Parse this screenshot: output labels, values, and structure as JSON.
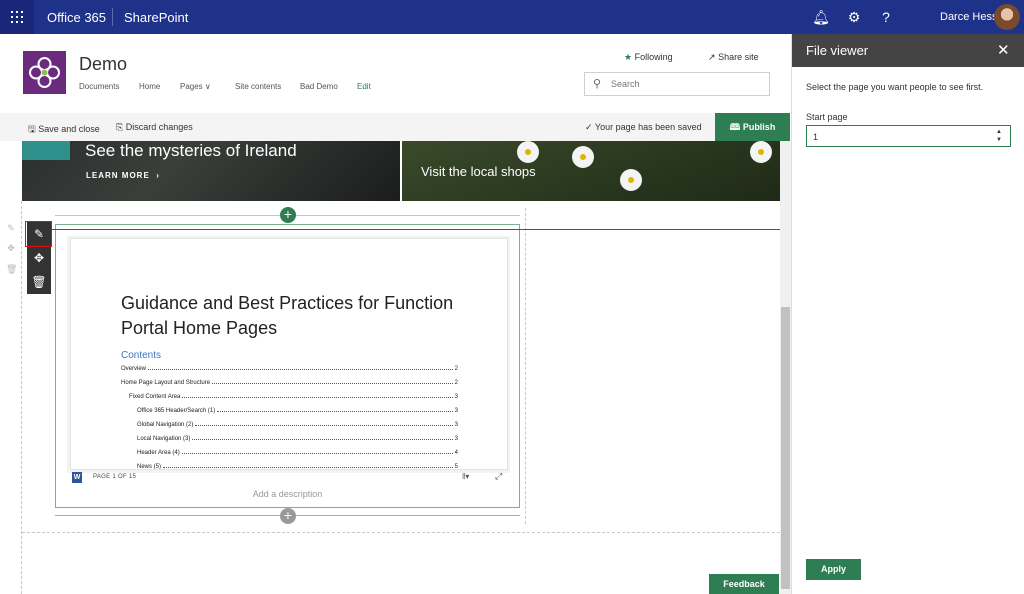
{
  "suite": {
    "app_launcher": "waffle-icon",
    "brand": "Office 365",
    "app": "SharePoint",
    "icons": [
      "bell-icon",
      "gear-icon",
      "help-icon"
    ],
    "user_name": "Darce Hess"
  },
  "site": {
    "title": "Demo",
    "nav": [
      "Documents",
      "Home",
      "Pages",
      "Site contents",
      "Bad Demo",
      "Edit"
    ],
    "following": "Following",
    "share": "Share site",
    "search_placeholder": "Search"
  },
  "command_bar": {
    "save_close": "Save and close",
    "discard": "Discard changes",
    "status": "Your page has been saved",
    "publish": "Publish"
  },
  "hero": {
    "left_title": "See the mysteries of Ireland",
    "left_link": "LEARN MORE",
    "right_title": "Visit the local shops"
  },
  "document": {
    "title": "Guidance and Best Practices for Function Portal Home Pages",
    "contents_heading": "Contents",
    "toc": [
      {
        "text": "Overview",
        "page": "2",
        "level": 0
      },
      {
        "text": "Home Page Layout and Structure",
        "page": "2",
        "level": 0
      },
      {
        "text": "Fixed Content Area",
        "page": "3",
        "level": 1
      },
      {
        "text": "Office 365 Header/Search (1)",
        "page": "3",
        "level": 2
      },
      {
        "text": "Global Navigation (2)",
        "page": "3",
        "level": 2
      },
      {
        "text": "Local Navigation (3)",
        "page": "3",
        "level": 2
      },
      {
        "text": "Header Area (4)",
        "page": "4",
        "level": 2
      },
      {
        "text": "News (5)",
        "page": "5",
        "level": 2
      }
    ],
    "page_count": "PAGE 1 OF 15",
    "description_placeholder": "Add a description"
  },
  "pane": {
    "title": "File viewer",
    "description": "Select the page you want people to see first.",
    "start_label": "Start page",
    "start_value": "1",
    "apply": "Apply"
  },
  "feedback": "Feedback",
  "colors": {
    "suite_bar": "#1f3289",
    "accent_green": "#2e7d53",
    "pane_header": "#444444",
    "annotation_red": "#e11111"
  }
}
